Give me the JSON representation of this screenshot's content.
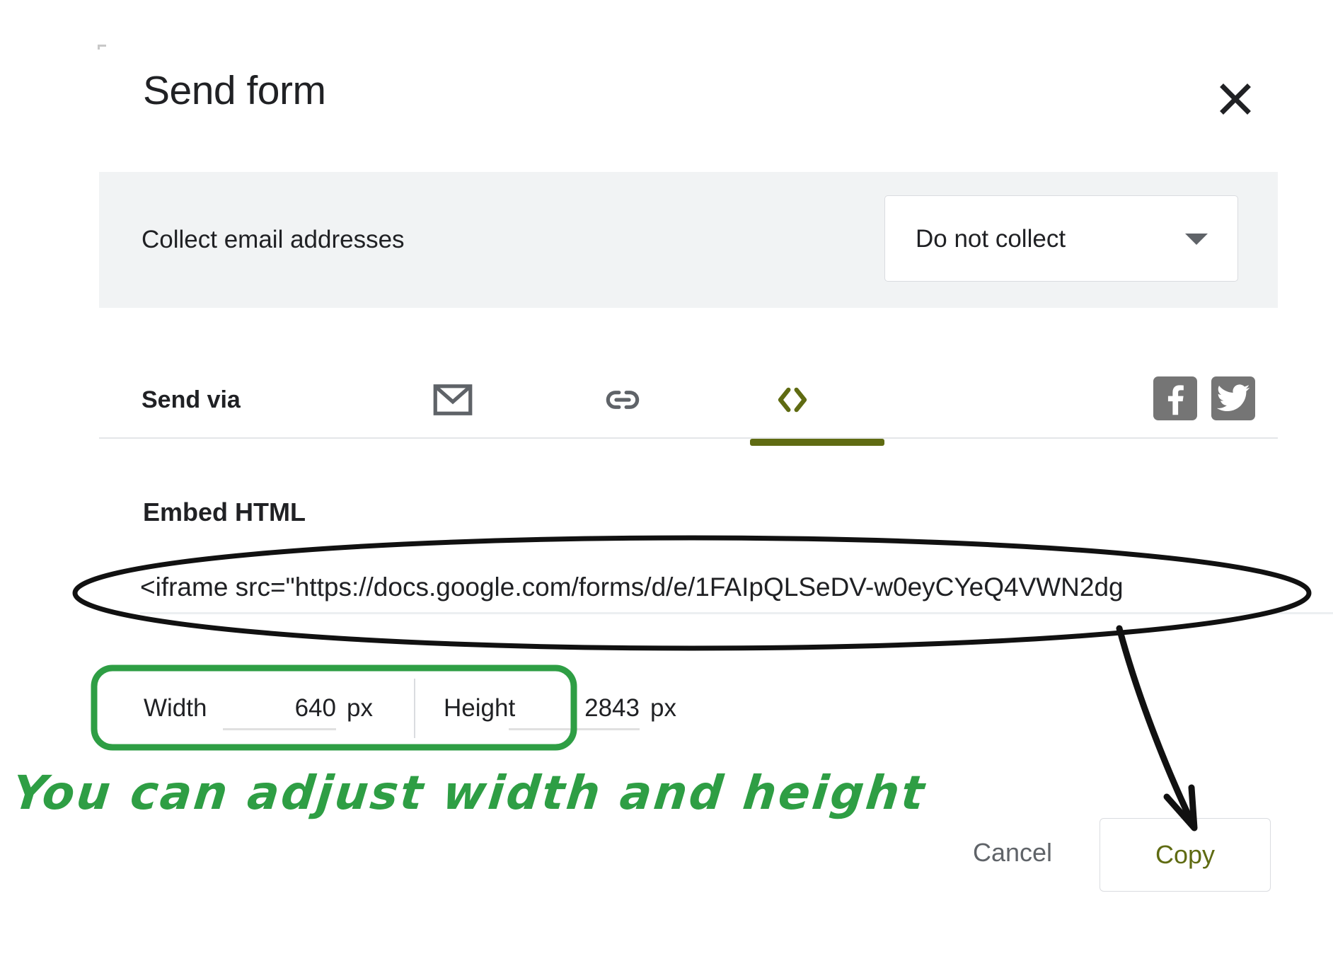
{
  "dialog": {
    "title": "Send form",
    "close_icon": "close-icon"
  },
  "collect_email": {
    "label": "Collect email addresses",
    "select_value": "Do not collect",
    "caret_icon": "chevron-down-icon"
  },
  "send_via": {
    "label": "Send via",
    "tabs": [
      {
        "icon": "email-icon",
        "name": "email",
        "active": false
      },
      {
        "icon": "link-icon",
        "name": "link",
        "active": false
      },
      {
        "icon": "code-embed-icon",
        "name": "embed",
        "active": true
      }
    ],
    "social": [
      {
        "icon": "facebook-icon",
        "name": "facebook"
      },
      {
        "icon": "twitter-icon",
        "name": "twitter"
      }
    ],
    "active_color": "#5f6b12"
  },
  "embed": {
    "heading": "Embed HTML",
    "input_value": "<iframe src=\"https://docs.google.com/forms/d/e/1FAIpQLSeDV-w0eyCYeQ4VWN2dg",
    "width": {
      "label": "Width",
      "value": "640",
      "unit": "px"
    },
    "height": {
      "label": "Height",
      "value": "2843",
      "unit": "px"
    }
  },
  "footer": {
    "cancel_label": "Cancel",
    "copy_label": "Copy",
    "copy_color": "#5f6b12"
  },
  "annotations": {
    "note_text": "You can adjust width and height",
    "note_color": "#2e9e44",
    "ellipse_color": "#111111",
    "box_color": "#2e9e44",
    "arrow_color": "#111111"
  }
}
